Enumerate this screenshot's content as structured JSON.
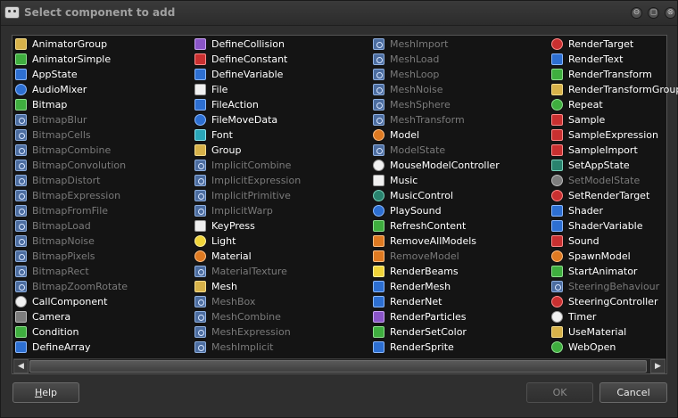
{
  "window": {
    "title": "Select component to add",
    "controls": {
      "minimize": "⊖",
      "maximize": "◻",
      "close": "⊗"
    }
  },
  "columns": [
    {
      "items": [
        {
          "label": "AnimatorGroup",
          "enabled": true,
          "icon": "animator-group-icon",
          "icon_style": "gold"
        },
        {
          "label": "AnimatorSimple",
          "enabled": true,
          "icon": "animator-simple-icon",
          "icon_style": "green"
        },
        {
          "label": "AppState",
          "enabled": true,
          "icon": "app-state-icon",
          "icon_style": "blue"
        },
        {
          "label": "AudioMixer",
          "enabled": true,
          "icon": "audio-mixer-icon",
          "icon_style": "blue",
          "round": true
        },
        {
          "label": "Bitmap",
          "enabled": true,
          "icon": "bitmap-icon",
          "icon_style": "green"
        },
        {
          "label": "BitmapBlur",
          "enabled": false,
          "icon": "default-component-icon",
          "icon_style": "default"
        },
        {
          "label": "BitmapCells",
          "enabled": false,
          "icon": "default-component-icon",
          "icon_style": "default"
        },
        {
          "label": "BitmapCombine",
          "enabled": false,
          "icon": "default-component-icon",
          "icon_style": "default"
        },
        {
          "label": "BitmapConvolution",
          "enabled": false,
          "icon": "default-component-icon",
          "icon_style": "default"
        },
        {
          "label": "BitmapDistort",
          "enabled": false,
          "icon": "default-component-icon",
          "icon_style": "default"
        },
        {
          "label": "BitmapExpression",
          "enabled": false,
          "icon": "default-component-icon",
          "icon_style": "default"
        },
        {
          "label": "BitmapFromFile",
          "enabled": false,
          "icon": "default-component-icon",
          "icon_style": "default"
        },
        {
          "label": "BitmapLoad",
          "enabled": false,
          "icon": "default-component-icon",
          "icon_style": "default"
        },
        {
          "label": "BitmapNoise",
          "enabled": false,
          "icon": "default-component-icon",
          "icon_style": "default"
        },
        {
          "label": "BitmapPixels",
          "enabled": false,
          "icon": "default-component-icon",
          "icon_style": "default"
        },
        {
          "label": "BitmapRect",
          "enabled": false,
          "icon": "default-component-icon",
          "icon_style": "default"
        },
        {
          "label": "BitmapZoomRotate",
          "enabled": false,
          "icon": "default-component-icon",
          "icon_style": "default"
        },
        {
          "label": "CallComponent",
          "enabled": true,
          "icon": "call-component-icon",
          "icon_style": "white",
          "round": true
        },
        {
          "label": "Camera",
          "enabled": true,
          "icon": "camera-icon",
          "icon_style": "gray"
        },
        {
          "label": "Condition",
          "enabled": true,
          "icon": "condition-icon",
          "icon_style": "green"
        },
        {
          "label": "DefineArray",
          "enabled": true,
          "icon": "define-array-icon",
          "icon_style": "blue"
        }
      ]
    },
    {
      "items": [
        {
          "label": "DefineCollision",
          "enabled": true,
          "icon": "define-collision-icon",
          "icon_style": "purple"
        },
        {
          "label": "DefineConstant",
          "enabled": true,
          "icon": "define-constant-icon",
          "icon_style": "red"
        },
        {
          "label": "DefineVariable",
          "enabled": true,
          "icon": "define-variable-icon",
          "icon_style": "blue"
        },
        {
          "label": "File",
          "enabled": true,
          "icon": "file-icon",
          "icon_style": "white"
        },
        {
          "label": "FileAction",
          "enabled": true,
          "icon": "file-action-icon",
          "icon_style": "blue"
        },
        {
          "label": "FileMoveData",
          "enabled": true,
          "icon": "file-move-data-icon",
          "icon_style": "blue",
          "round": true
        },
        {
          "label": "Font",
          "enabled": true,
          "icon": "font-icon",
          "icon_style": "cyan"
        },
        {
          "label": "Group",
          "enabled": true,
          "icon": "group-folder-icon",
          "icon_style": "gold"
        },
        {
          "label": "ImplicitCombine",
          "enabled": false,
          "icon": "default-component-icon",
          "icon_style": "default"
        },
        {
          "label": "ImplicitExpression",
          "enabled": false,
          "icon": "default-component-icon",
          "icon_style": "default"
        },
        {
          "label": "ImplicitPrimitive",
          "enabled": false,
          "icon": "default-component-icon",
          "icon_style": "default"
        },
        {
          "label": "ImplicitWarp",
          "enabled": false,
          "icon": "default-component-icon",
          "icon_style": "default"
        },
        {
          "label": "KeyPress",
          "enabled": true,
          "icon": "keyboard-icon",
          "icon_style": "white"
        },
        {
          "label": "Light",
          "enabled": true,
          "icon": "light-bulb-icon",
          "icon_style": "yellow",
          "round": true
        },
        {
          "label": "Material",
          "enabled": true,
          "icon": "material-palette-icon",
          "icon_style": "orange",
          "round": true
        },
        {
          "label": "MaterialTexture",
          "enabled": false,
          "icon": "default-component-icon",
          "icon_style": "default"
        },
        {
          "label": "Mesh",
          "enabled": true,
          "icon": "mesh-icon",
          "icon_style": "gold"
        },
        {
          "label": "MeshBox",
          "enabled": false,
          "icon": "default-component-icon",
          "icon_style": "default"
        },
        {
          "label": "MeshCombine",
          "enabled": false,
          "icon": "default-component-icon",
          "icon_style": "default"
        },
        {
          "label": "MeshExpression",
          "enabled": false,
          "icon": "default-component-icon",
          "icon_style": "default"
        },
        {
          "label": "MeshImplicit",
          "enabled": false,
          "icon": "default-component-icon",
          "icon_style": "default"
        }
      ]
    },
    {
      "items": [
        {
          "label": "MeshImport",
          "enabled": false,
          "icon": "default-component-icon",
          "icon_style": "default"
        },
        {
          "label": "MeshLoad",
          "enabled": false,
          "icon": "default-component-icon",
          "icon_style": "default"
        },
        {
          "label": "MeshLoop",
          "enabled": false,
          "icon": "default-component-icon",
          "icon_style": "default"
        },
        {
          "label": "MeshNoise",
          "enabled": false,
          "icon": "default-component-icon",
          "icon_style": "default"
        },
        {
          "label": "MeshSphere",
          "enabled": false,
          "icon": "default-component-icon",
          "icon_style": "default"
        },
        {
          "label": "MeshTransform",
          "enabled": false,
          "icon": "default-component-icon",
          "icon_style": "default"
        },
        {
          "label": "Model",
          "enabled": true,
          "icon": "model-person-icon",
          "icon_style": "orange",
          "round": true
        },
        {
          "label": "ModelState",
          "enabled": false,
          "icon": "default-component-icon",
          "icon_style": "default"
        },
        {
          "label": "MouseModelController",
          "enabled": true,
          "icon": "mouse-icon",
          "icon_style": "white",
          "round": true
        },
        {
          "label": "Music",
          "enabled": true,
          "icon": "music-note-icon",
          "icon_style": "white"
        },
        {
          "label": "MusicControl",
          "enabled": true,
          "icon": "music-control-icon",
          "icon_style": "teal",
          "round": true
        },
        {
          "label": "PlaySound",
          "enabled": true,
          "icon": "play-sound-icon",
          "icon_style": "blue",
          "round": true
        },
        {
          "label": "RefreshContent",
          "enabled": true,
          "icon": "refresh-icon",
          "icon_style": "green"
        },
        {
          "label": "RemoveAllModels",
          "enabled": true,
          "icon": "remove-all-models-icon",
          "icon_style": "orange"
        },
        {
          "label": "RemoveModel",
          "enabled": false,
          "icon": "remove-model-icon",
          "icon_style": "orange"
        },
        {
          "label": "RenderBeams",
          "enabled": true,
          "icon": "render-beams-icon",
          "icon_style": "yellow"
        },
        {
          "label": "RenderMesh",
          "enabled": true,
          "icon": "render-mesh-icon",
          "icon_style": "blue"
        },
        {
          "label": "RenderNet",
          "enabled": true,
          "icon": "render-net-icon",
          "icon_style": "blue"
        },
        {
          "label": "RenderParticles",
          "enabled": true,
          "icon": "render-particles-icon",
          "icon_style": "purple"
        },
        {
          "label": "RenderSetColor",
          "enabled": true,
          "icon": "render-set-color-icon",
          "icon_style": "green"
        },
        {
          "label": "RenderSprite",
          "enabled": true,
          "icon": "render-sprite-icon",
          "icon_style": "blue"
        }
      ]
    },
    {
      "items": [
        {
          "label": "RenderTarget",
          "enabled": true,
          "icon": "render-target-icon",
          "icon_style": "red",
          "round": true
        },
        {
          "label": "RenderText",
          "enabled": true,
          "icon": "render-text-icon",
          "icon_style": "blue"
        },
        {
          "label": "RenderTransform",
          "enabled": true,
          "icon": "render-transform-icon",
          "icon_style": "green"
        },
        {
          "label": "RenderTransformGroup",
          "enabled": true,
          "icon": "render-transform-group-icon",
          "icon_style": "gold"
        },
        {
          "label": "Repeat",
          "enabled": true,
          "icon": "repeat-icon",
          "icon_style": "green",
          "round": true
        },
        {
          "label": "Sample",
          "enabled": true,
          "icon": "sample-icon",
          "icon_style": "red"
        },
        {
          "label": "SampleExpression",
          "enabled": true,
          "icon": "sample-expression-icon",
          "icon_style": "red"
        },
        {
          "label": "SampleImport",
          "enabled": true,
          "icon": "sample-import-icon",
          "icon_style": "red"
        },
        {
          "label": "SetAppState",
          "enabled": true,
          "icon": "set-app-state-icon",
          "icon_style": "teal"
        },
        {
          "label": "SetModelState",
          "enabled": false,
          "icon": "set-model-state-icon",
          "icon_style": "gray",
          "round": true
        },
        {
          "label": "SetRenderTarget",
          "enabled": true,
          "icon": "set-render-target-icon",
          "icon_style": "red",
          "round": true
        },
        {
          "label": "Shader",
          "enabled": true,
          "icon": "shader-icon",
          "icon_style": "blue"
        },
        {
          "label": "ShaderVariable",
          "enabled": true,
          "icon": "shader-variable-icon",
          "icon_style": "blue"
        },
        {
          "label": "Sound",
          "enabled": true,
          "icon": "sound-icon",
          "icon_style": "red"
        },
        {
          "label": "SpawnModel",
          "enabled": true,
          "icon": "spawn-model-icon",
          "icon_style": "orange",
          "round": true
        },
        {
          "label": "StartAnimator",
          "enabled": true,
          "icon": "start-animator-icon",
          "icon_style": "green"
        },
        {
          "label": "SteeringBehaviour",
          "enabled": false,
          "icon": "default-component-icon",
          "icon_style": "default"
        },
        {
          "label": "SteeringController",
          "enabled": true,
          "icon": "steering-wheel-icon",
          "icon_style": "red",
          "round": true
        },
        {
          "label": "Timer",
          "enabled": true,
          "icon": "timer-clock-icon",
          "icon_style": "white",
          "round": true
        },
        {
          "label": "UseMaterial",
          "enabled": true,
          "icon": "use-material-icon",
          "icon_style": "gold"
        },
        {
          "label": "WebOpen",
          "enabled": true,
          "icon": "web-globe-icon",
          "icon_style": "green",
          "round": true
        }
      ]
    }
  ],
  "scrollbar": {
    "left_arrow": "◀",
    "right_arrow": "▶"
  },
  "buttons": {
    "help": "Help",
    "ok": "OK",
    "cancel": "Cancel",
    "ok_enabled": false
  }
}
